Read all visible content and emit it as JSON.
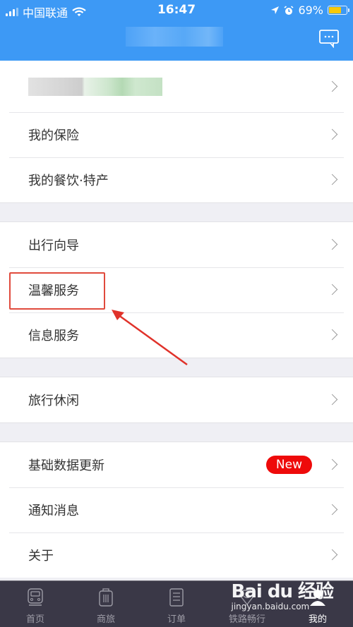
{
  "status_bar": {
    "carrier": "中国联通",
    "time": "16:47",
    "battery_percent_label": "69%",
    "battery_level": 0.69,
    "icons": [
      "signal-icon",
      "wifi-icon",
      "location-icon",
      "alarm-icon",
      "battery-icon"
    ]
  },
  "nav": {
    "title": "",
    "right_icon": "chat-bubble-icon"
  },
  "groups": [
    {
      "items": [
        {
          "label": "",
          "obscured": true
        },
        {
          "label": "我的保险"
        },
        {
          "label": "我的餐饮·特产"
        }
      ]
    },
    {
      "items": [
        {
          "label": "出行向导"
        },
        {
          "label": "温馨服务",
          "highlighted": true
        },
        {
          "label": "信息服务"
        }
      ]
    },
    {
      "items": [
        {
          "label": "旅行休闲"
        }
      ]
    },
    {
      "items": [
        {
          "label": "基础数据更新",
          "badge": "New"
        },
        {
          "label": "通知消息"
        },
        {
          "label": "关于"
        }
      ]
    }
  ],
  "tabbar": {
    "items": [
      {
        "label": "首页",
        "icon": "train-icon"
      },
      {
        "label": "商旅",
        "icon": "luggage-icon"
      },
      {
        "label": "订单",
        "icon": "order-list-icon"
      },
      {
        "label": "铁路畅行",
        "icon": "diamond-icon"
      },
      {
        "label": "我的",
        "icon": "user-icon",
        "active": true
      }
    ]
  },
  "watermark": {
    "logo": "Bai du 经验",
    "url": "jingyan.baidu.com"
  },
  "colors": {
    "header_bg": "#3d99f5",
    "badge_red": "#ee0a0a",
    "highlight_red": "#e04a3c",
    "tabbar_bg": "#3a3847"
  }
}
